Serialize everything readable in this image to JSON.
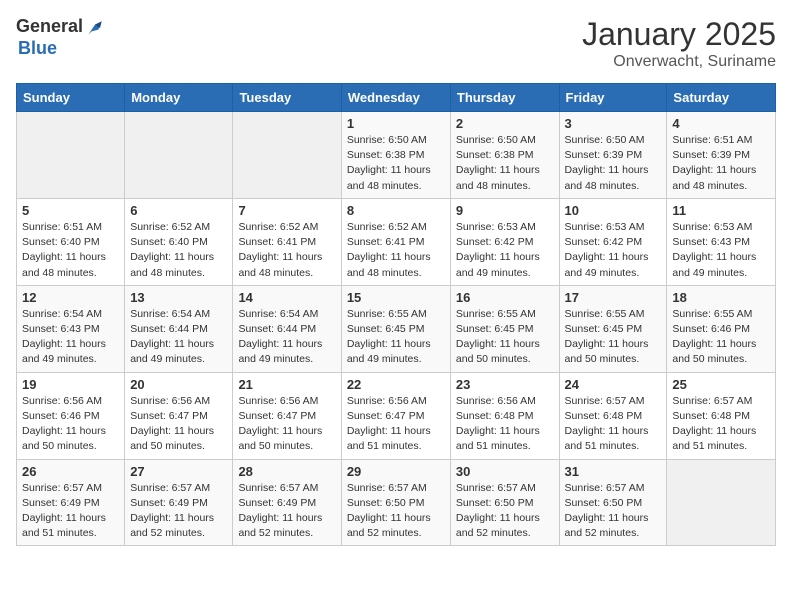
{
  "header": {
    "logo_general": "General",
    "logo_blue": "Blue",
    "month": "January 2025",
    "location": "Onverwacht, Suriname"
  },
  "weekdays": [
    "Sunday",
    "Monday",
    "Tuesday",
    "Wednesday",
    "Thursday",
    "Friday",
    "Saturday"
  ],
  "weeks": [
    [
      {
        "day": "",
        "info": ""
      },
      {
        "day": "",
        "info": ""
      },
      {
        "day": "",
        "info": ""
      },
      {
        "day": "1",
        "info": "Sunrise: 6:50 AM\nSunset: 6:38 PM\nDaylight: 11 hours and 48 minutes."
      },
      {
        "day": "2",
        "info": "Sunrise: 6:50 AM\nSunset: 6:38 PM\nDaylight: 11 hours and 48 minutes."
      },
      {
        "day": "3",
        "info": "Sunrise: 6:50 AM\nSunset: 6:39 PM\nDaylight: 11 hours and 48 minutes."
      },
      {
        "day": "4",
        "info": "Sunrise: 6:51 AM\nSunset: 6:39 PM\nDaylight: 11 hours and 48 minutes."
      }
    ],
    [
      {
        "day": "5",
        "info": "Sunrise: 6:51 AM\nSunset: 6:40 PM\nDaylight: 11 hours and 48 minutes."
      },
      {
        "day": "6",
        "info": "Sunrise: 6:52 AM\nSunset: 6:40 PM\nDaylight: 11 hours and 48 minutes."
      },
      {
        "day": "7",
        "info": "Sunrise: 6:52 AM\nSunset: 6:41 PM\nDaylight: 11 hours and 48 minutes."
      },
      {
        "day": "8",
        "info": "Sunrise: 6:52 AM\nSunset: 6:41 PM\nDaylight: 11 hours and 48 minutes."
      },
      {
        "day": "9",
        "info": "Sunrise: 6:53 AM\nSunset: 6:42 PM\nDaylight: 11 hours and 49 minutes."
      },
      {
        "day": "10",
        "info": "Sunrise: 6:53 AM\nSunset: 6:42 PM\nDaylight: 11 hours and 49 minutes."
      },
      {
        "day": "11",
        "info": "Sunrise: 6:53 AM\nSunset: 6:43 PM\nDaylight: 11 hours and 49 minutes."
      }
    ],
    [
      {
        "day": "12",
        "info": "Sunrise: 6:54 AM\nSunset: 6:43 PM\nDaylight: 11 hours and 49 minutes."
      },
      {
        "day": "13",
        "info": "Sunrise: 6:54 AM\nSunset: 6:44 PM\nDaylight: 11 hours and 49 minutes."
      },
      {
        "day": "14",
        "info": "Sunrise: 6:54 AM\nSunset: 6:44 PM\nDaylight: 11 hours and 49 minutes."
      },
      {
        "day": "15",
        "info": "Sunrise: 6:55 AM\nSunset: 6:45 PM\nDaylight: 11 hours and 49 minutes."
      },
      {
        "day": "16",
        "info": "Sunrise: 6:55 AM\nSunset: 6:45 PM\nDaylight: 11 hours and 50 minutes."
      },
      {
        "day": "17",
        "info": "Sunrise: 6:55 AM\nSunset: 6:45 PM\nDaylight: 11 hours and 50 minutes."
      },
      {
        "day": "18",
        "info": "Sunrise: 6:55 AM\nSunset: 6:46 PM\nDaylight: 11 hours and 50 minutes."
      }
    ],
    [
      {
        "day": "19",
        "info": "Sunrise: 6:56 AM\nSunset: 6:46 PM\nDaylight: 11 hours and 50 minutes."
      },
      {
        "day": "20",
        "info": "Sunrise: 6:56 AM\nSunset: 6:47 PM\nDaylight: 11 hours and 50 minutes."
      },
      {
        "day": "21",
        "info": "Sunrise: 6:56 AM\nSunset: 6:47 PM\nDaylight: 11 hours and 50 minutes."
      },
      {
        "day": "22",
        "info": "Sunrise: 6:56 AM\nSunset: 6:47 PM\nDaylight: 11 hours and 51 minutes."
      },
      {
        "day": "23",
        "info": "Sunrise: 6:56 AM\nSunset: 6:48 PM\nDaylight: 11 hours and 51 minutes."
      },
      {
        "day": "24",
        "info": "Sunrise: 6:57 AM\nSunset: 6:48 PM\nDaylight: 11 hours and 51 minutes."
      },
      {
        "day": "25",
        "info": "Sunrise: 6:57 AM\nSunset: 6:48 PM\nDaylight: 11 hours and 51 minutes."
      }
    ],
    [
      {
        "day": "26",
        "info": "Sunrise: 6:57 AM\nSunset: 6:49 PM\nDaylight: 11 hours and 51 minutes."
      },
      {
        "day": "27",
        "info": "Sunrise: 6:57 AM\nSunset: 6:49 PM\nDaylight: 11 hours and 52 minutes."
      },
      {
        "day": "28",
        "info": "Sunrise: 6:57 AM\nSunset: 6:49 PM\nDaylight: 11 hours and 52 minutes."
      },
      {
        "day": "29",
        "info": "Sunrise: 6:57 AM\nSunset: 6:50 PM\nDaylight: 11 hours and 52 minutes."
      },
      {
        "day": "30",
        "info": "Sunrise: 6:57 AM\nSunset: 6:50 PM\nDaylight: 11 hours and 52 minutes."
      },
      {
        "day": "31",
        "info": "Sunrise: 6:57 AM\nSunset: 6:50 PM\nDaylight: 11 hours and 52 minutes."
      },
      {
        "day": "",
        "info": ""
      }
    ]
  ]
}
